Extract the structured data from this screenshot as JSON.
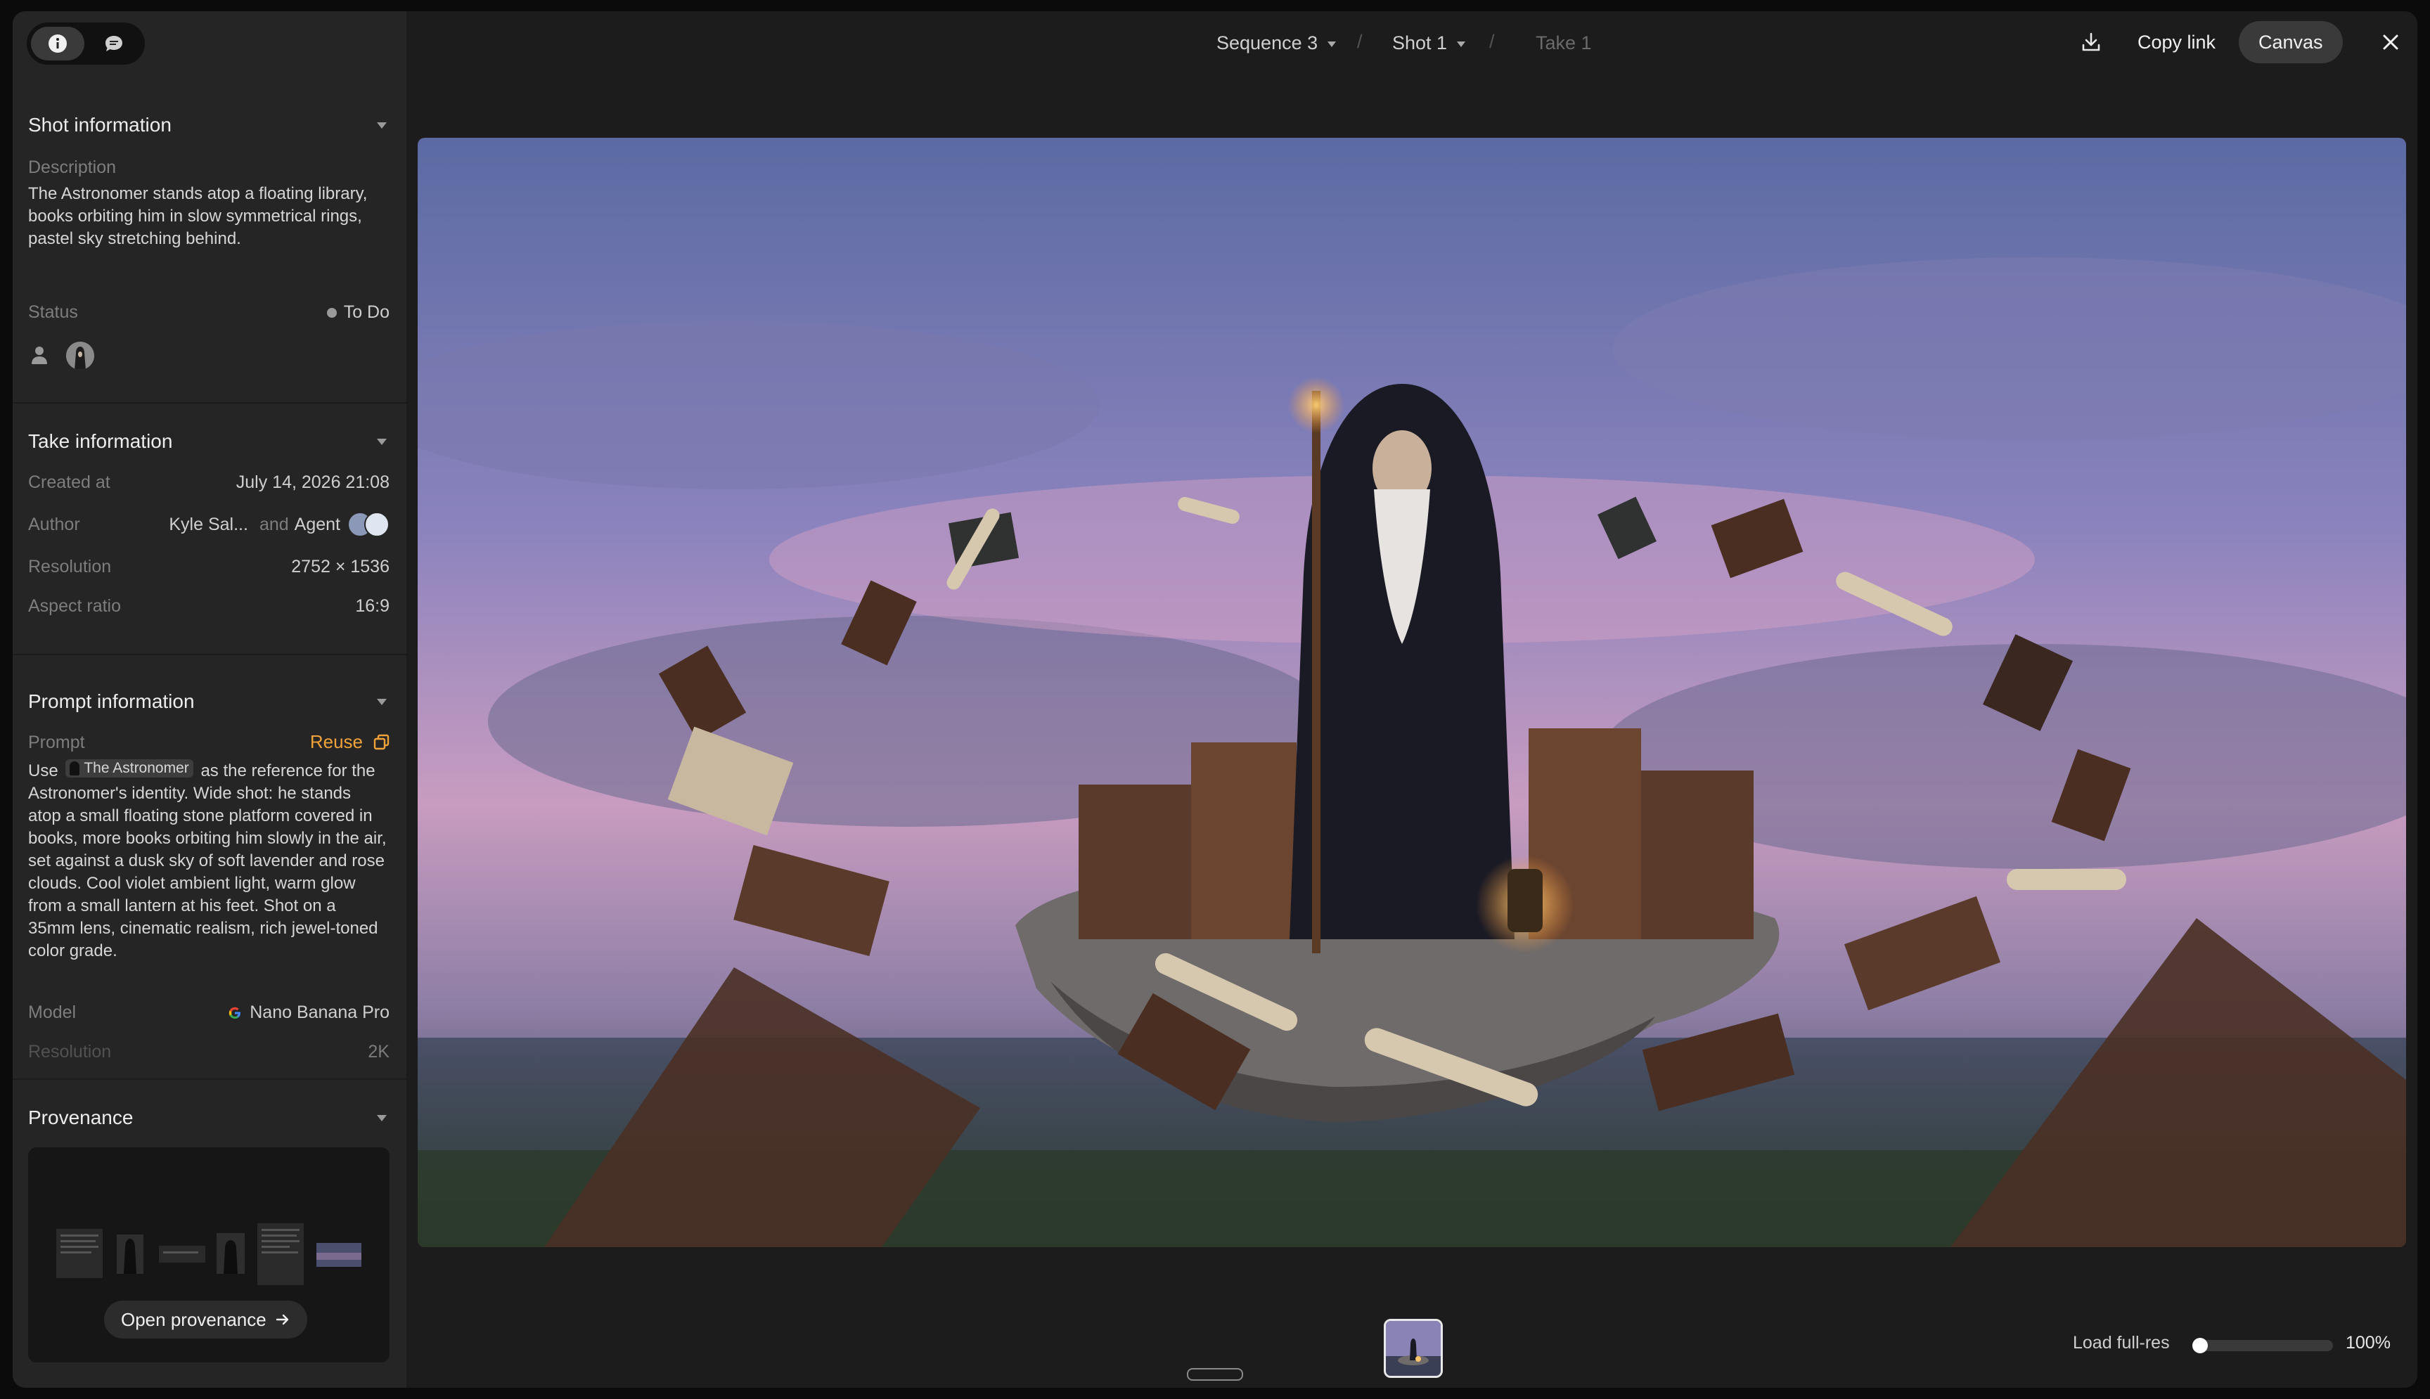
{
  "sidebar": {
    "tabs": [
      {
        "icon": "info-icon"
      },
      {
        "icon": "comment-icon"
      }
    ],
    "shot": {
      "title": "Shot information",
      "description_label": "Description",
      "description": "The Astronomer stands atop a floating library, books orbiting him in slow symmetrical rings, pastel sky stretching behind.",
      "status_label": "Status",
      "status_value": "To Do"
    },
    "take": {
      "title": "Take information",
      "created_label": "Created at",
      "created_value": "July 14, 2026 21:08",
      "author_label": "Author",
      "author_name": "Kyle Sal...",
      "author_and": "and",
      "author_agent": "Agent",
      "resolution_label": "Resolution",
      "resolution_value": "2752 × 1536",
      "aspect_label": "Aspect ratio",
      "aspect_value": "16:9"
    },
    "prompt": {
      "title": "Prompt information",
      "prompt_label": "Prompt",
      "reuse_label": "Reuse",
      "text_pre": "Use",
      "chip": "The Astronomer",
      "text_post": "as the reference for the Astronomer's identity. Wide shot: he stands atop a small floating stone platform covered in books, more books orbiting him slowly in the air, set against a dusk sky of soft lavender and rose clouds. Cool violet ambient light, warm glow from a small lantern at his feet. Shot on a 35mm lens, cinematic realism, rich jewel-toned color grade.",
      "model_label": "Model",
      "model_value": "Nano Banana Pro",
      "resolution_label": "Resolution",
      "resolution_value": "2K"
    },
    "provenance": {
      "title": "Provenance",
      "open_label": "Open provenance"
    }
  },
  "topbar": {
    "sequence": "Sequence 3",
    "shot": "Shot 1",
    "take": "Take 1",
    "copy_link": "Copy link",
    "canvas": "Canvas"
  },
  "footer": {
    "load_label": "Load full-res",
    "zoom": "100%",
    "load_progress": 0.0
  },
  "colors": {
    "accent": "#f0a23a",
    "status_dot": "#9a9a9a"
  }
}
